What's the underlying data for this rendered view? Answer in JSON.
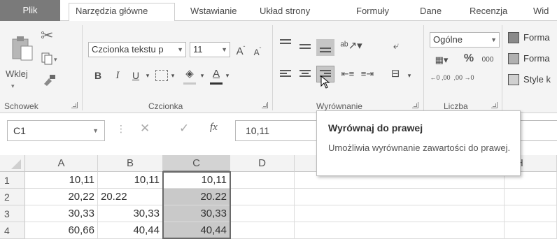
{
  "tabs": {
    "file": "Plik",
    "home": "Narzędzia główne",
    "insert": "Wstawianie",
    "layout": "Układ strony",
    "formulas": "Formuły",
    "data": "Dane",
    "review": "Recenzja",
    "view": "Wid"
  },
  "clipboard": {
    "paste_label": "Wklej",
    "group_label": "Schowek"
  },
  "font": {
    "name": "Czcionka tekstu p",
    "size": "11",
    "bold": "B",
    "italic": "I",
    "underline": "U",
    "group_label": "Czcionka"
  },
  "alignment": {
    "group_label": "Wyrównanie"
  },
  "number": {
    "format": "Ogólne",
    "percent": "%",
    "thousands": "000",
    "inc_decimal": "←0 ,00",
    "dec_decimal": ",00 →0",
    "group_label": "Liczba"
  },
  "styles": {
    "conditional": "Forma",
    "table": "Forma",
    "cell_styles": "Style k"
  },
  "formula_bar": {
    "name_box": "C1",
    "fx": "fx",
    "value": "10,11"
  },
  "tooltip": {
    "title": "Wyrównaj do prawej",
    "body": "Umożliwia wyrównanie zawartości do prawej."
  },
  "grid": {
    "columns": [
      "A",
      "B",
      "C",
      "D",
      "H"
    ],
    "rows": [
      {
        "num": "1",
        "a": "10,11",
        "b": "10,11",
        "c": "10,11"
      },
      {
        "num": "2",
        "a": "20,22",
        "b": "20.22",
        "c": "20.22"
      },
      {
        "num": "3",
        "a": "30,33",
        "b": "30,33",
        "c": "30,33"
      },
      {
        "num": "4",
        "a": "60,66",
        "b": "40,44",
        "c": "40,44"
      }
    ]
  },
  "colors": {
    "file_tab": "#7a7a7a",
    "selection": "#c9c9c9",
    "ribbon": "#f4f4f4"
  }
}
